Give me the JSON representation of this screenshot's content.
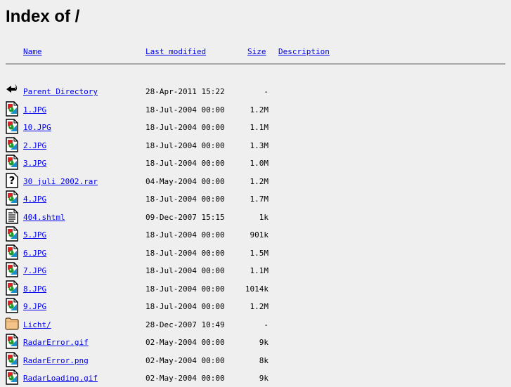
{
  "page": {
    "title": "Index of /"
  },
  "columns": {
    "name": "Name",
    "last_modified": "Last modified",
    "size": "Size",
    "description": "Description"
  },
  "colors": {
    "link": "#0000ee",
    "background": "#efefef",
    "rule": "#a8a8a8"
  },
  "entries": [
    {
      "icon": "back-icon",
      "name": "Parent Directory",
      "modified": "28-Apr-2011 15:22",
      "size": "-",
      "description": ""
    },
    {
      "icon": "image-icon",
      "name": "1.JPG",
      "modified": "18-Jul-2004 00:00",
      "size": "1.2M",
      "description": ""
    },
    {
      "icon": "image-icon",
      "name": "10.JPG",
      "modified": "18-Jul-2004 00:00",
      "size": "1.1M",
      "description": ""
    },
    {
      "icon": "image-icon",
      "name": "2.JPG",
      "modified": "18-Jul-2004 00:00",
      "size": "1.3M",
      "description": ""
    },
    {
      "icon": "image-icon",
      "name": "3.JPG",
      "modified": "18-Jul-2004 00:00",
      "size": "1.0M",
      "description": ""
    },
    {
      "icon": "unknown-icon",
      "name": "30 juli 2002.rar",
      "modified": "04-May-2004 00:00",
      "size": "1.2M",
      "description": ""
    },
    {
      "icon": "image-icon",
      "name": "4.JPG",
      "modified": "18-Jul-2004 00:00",
      "size": "1.7M",
      "description": ""
    },
    {
      "icon": "text-icon",
      "name": "404.shtml",
      "modified": "09-Dec-2007 15:15",
      "size": "1k",
      "description": ""
    },
    {
      "icon": "image-icon",
      "name": "5.JPG",
      "modified": "18-Jul-2004 00:00",
      "size": "901k",
      "description": ""
    },
    {
      "icon": "image-icon",
      "name": "6.JPG",
      "modified": "18-Jul-2004 00:00",
      "size": "1.5M",
      "description": ""
    },
    {
      "icon": "image-icon",
      "name": "7.JPG",
      "modified": "18-Jul-2004 00:00",
      "size": "1.1M",
      "description": ""
    },
    {
      "icon": "image-icon",
      "name": "8.JPG",
      "modified": "18-Jul-2004 00:00",
      "size": "1014k",
      "description": ""
    },
    {
      "icon": "image-icon",
      "name": "9.JPG",
      "modified": "18-Jul-2004 00:00",
      "size": "1.2M",
      "description": ""
    },
    {
      "icon": "folder-icon",
      "name": "Licht/",
      "modified": "28-Dec-2007 10:49",
      "size": "-",
      "description": ""
    },
    {
      "icon": "image-icon",
      "name": "RadarError.gif",
      "modified": "02-May-2004 00:00",
      "size": "9k",
      "description": ""
    },
    {
      "icon": "image-icon",
      "name": "RadarError.png",
      "modified": "02-May-2004 00:00",
      "size": "8k",
      "description": ""
    },
    {
      "icon": "image-icon",
      "name": "RadarLoading.gif",
      "modified": "02-May-2004 00:00",
      "size": "9k",
      "description": ""
    }
  ]
}
